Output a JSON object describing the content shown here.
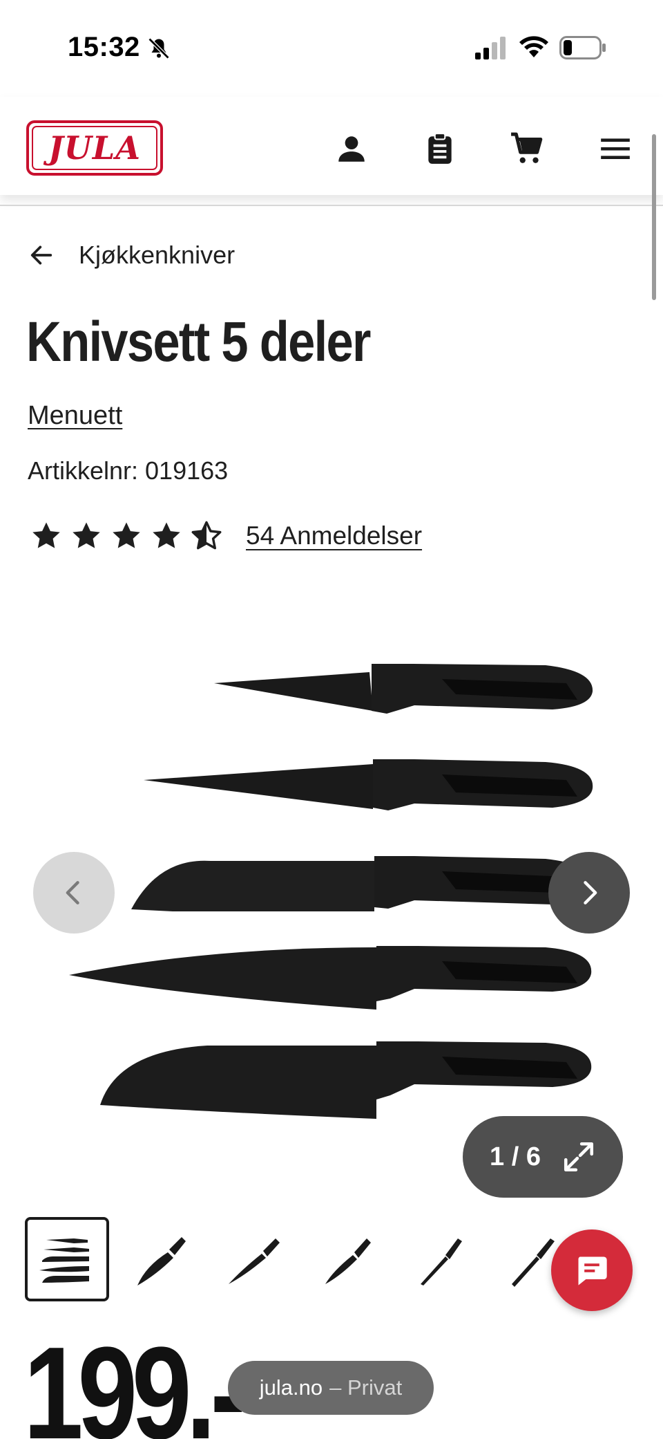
{
  "status_bar": {
    "time": "15:32",
    "icons": [
      "bell-muted-icon",
      "cellular-signal-icon",
      "wifi-icon",
      "battery-icon"
    ]
  },
  "header": {
    "logo_text": "JULA",
    "icons": [
      "account-icon",
      "shopping-list-icon",
      "cart-icon",
      "menu-icon"
    ],
    "brand_color": "#c8102e"
  },
  "breadcrumb": {
    "label": "Kjøkkenkniver"
  },
  "product": {
    "title": "Knivsett 5 deler",
    "brand": "Menuett",
    "article_number": "Artikkelnr: 019163",
    "rating": 4.5,
    "rating_max": 5,
    "reviews_label": "54 Anmeldelser",
    "price": "199.-"
  },
  "gallery": {
    "counter": "1 / 6",
    "thumbnail_count": 6,
    "active_index": 0
  },
  "browser": {
    "domain": "jula.no",
    "mode": "– Privat"
  },
  "colors": {
    "accent": "#d42b3a",
    "dark_button": "#4d4d4d",
    "light_button": "#d8d8d8"
  }
}
